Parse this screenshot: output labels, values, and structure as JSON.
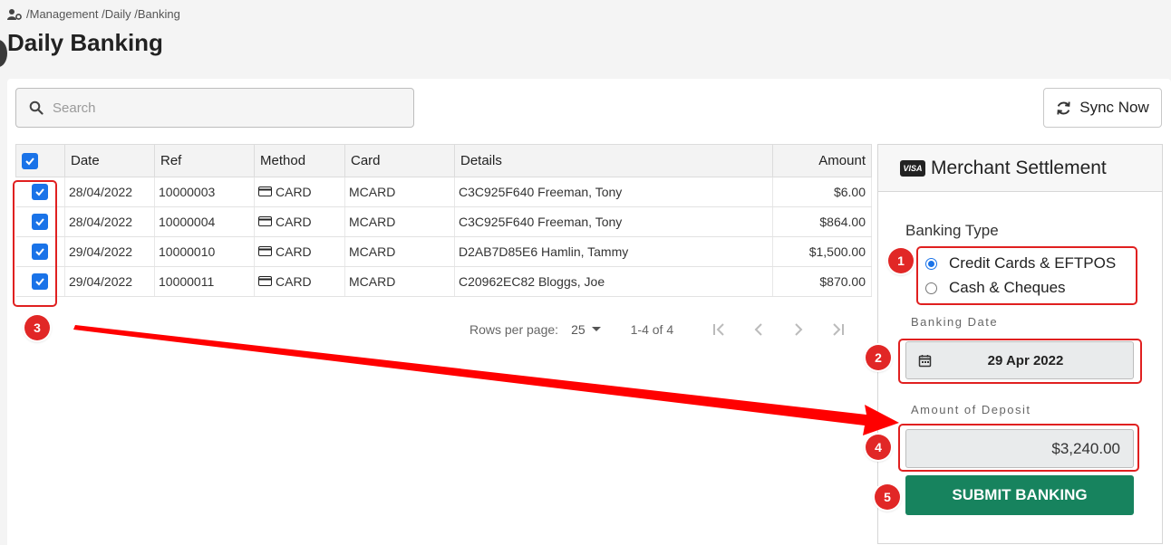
{
  "breadcrumb": {
    "icon": "users-gear-icon",
    "text": "/Management /Daily /Banking"
  },
  "page_title": "Daily Banking",
  "search": {
    "placeholder": "Search",
    "value": ""
  },
  "sync_button": {
    "label": "Sync Now",
    "icon": "refresh-icon"
  },
  "table": {
    "columns": [
      "Date",
      "Ref",
      "Method",
      "Card",
      "Details",
      "Amount"
    ],
    "rows": [
      {
        "checked": true,
        "date": "28/04/2022",
        "ref": "10000003",
        "method": "CARD",
        "card": "MCARD",
        "details": "C3C925F640 Freeman, Tony",
        "amount": "$6.00"
      },
      {
        "checked": true,
        "date": "28/04/2022",
        "ref": "10000004",
        "method": "CARD",
        "card": "MCARD",
        "details": "C3C925F640 Freeman, Tony",
        "amount": "$864.00"
      },
      {
        "checked": true,
        "date": "29/04/2022",
        "ref": "10000010",
        "method": "CARD",
        "card": "MCARD",
        "details": "D2AB7D85E6 Hamlin, Tammy",
        "amount": "$1,500.00"
      },
      {
        "checked": true,
        "date": "29/04/2022",
        "ref": "10000011",
        "method": "CARD",
        "card": "MCARD",
        "details": "C20962EC82 Bloggs, Joe",
        "amount": "$870.00"
      }
    ]
  },
  "pagination": {
    "rows_per_page_label": "Rows per page:",
    "rows_per_page": "25",
    "range": "1-4 of 4"
  },
  "panel": {
    "badge": "VISA",
    "title": "Merchant Settlement",
    "banking_type_label": "Banking Type",
    "options": [
      {
        "label": "Credit Cards & EFTPOS",
        "selected": true
      },
      {
        "label": "Cash & Cheques",
        "selected": false
      }
    ],
    "banking_date_label": "Banking Date",
    "banking_date": "29 Apr 2022",
    "deposit_label": "Amount of Deposit",
    "deposit_amount": "$3,240.00",
    "submit_label": "SUBMIT BANKING"
  },
  "annotations": [
    "1",
    "2",
    "3",
    "4",
    "5"
  ],
  "colors": {
    "accent": "#1a73e8",
    "submit": "#17835e",
    "annotation": "#e12726"
  }
}
